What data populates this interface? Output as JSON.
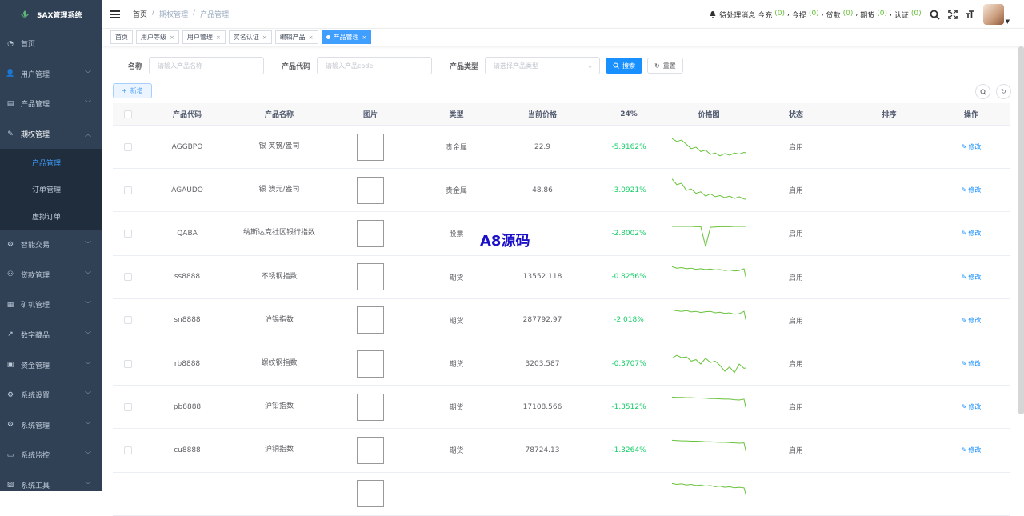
{
  "app": {
    "title": "SAX管理系统"
  },
  "sidebar": {
    "items": [
      {
        "label": "首页",
        "icon": "dashboard-icon",
        "has_arrow": false
      },
      {
        "label": "用户管理",
        "icon": "user-icon",
        "has_arrow": true
      },
      {
        "label": "产品管理",
        "icon": "document-icon",
        "has_arrow": true
      },
      {
        "label": "期权管理",
        "icon": "edit-icon",
        "has_arrow": true,
        "open": true,
        "children": [
          {
            "label": "产品管理",
            "active": true
          },
          {
            "label": "订单管理",
            "active": false
          },
          {
            "label": "虚拟订单",
            "active": false
          }
        ]
      },
      {
        "label": "智能交易",
        "icon": "gear-icon",
        "has_arrow": true
      },
      {
        "label": "贷款管理",
        "icon": "people-icon",
        "has_arrow": true
      },
      {
        "label": "矿机管理",
        "icon": "chart-icon",
        "has_arrow": true
      },
      {
        "label": "数字藏品",
        "icon": "trend-icon",
        "has_arrow": true
      },
      {
        "label": "资金管理",
        "icon": "money-icon",
        "has_arrow": true
      },
      {
        "label": "系统设置",
        "icon": "settings-icon",
        "has_arrow": true
      },
      {
        "label": "系统管理",
        "icon": "system-icon",
        "has_arrow": true
      },
      {
        "label": "系统监控",
        "icon": "monitor-icon",
        "has_arrow": true
      },
      {
        "label": "系统工具",
        "icon": "tool-icon",
        "has_arrow": true
      }
    ]
  },
  "breadcrumb": {
    "home": "首页",
    "sep": "/",
    "level1": "期权管理",
    "level2": "产品管理"
  },
  "notices": {
    "label": "待处理消息",
    "items": [
      {
        "label": "今充",
        "count": "(0)"
      },
      {
        "label": "今提",
        "count": "(0)"
      },
      {
        "label": "贷款",
        "count": "(0)"
      },
      {
        "label": "期货",
        "count": "(0)"
      },
      {
        "label": "认证",
        "count": "(0)"
      }
    ]
  },
  "tags": [
    {
      "label": "首页",
      "closable": false,
      "active": false
    },
    {
      "label": "用户等级",
      "closable": true,
      "active": false
    },
    {
      "label": "用户管理",
      "closable": true,
      "active": false
    },
    {
      "label": "实名认证",
      "closable": true,
      "active": false
    },
    {
      "label": "编辑产品",
      "closable": true,
      "active": false
    },
    {
      "label": "产品管理",
      "closable": true,
      "active": true
    }
  ],
  "filter": {
    "name_label": "名称",
    "name_placeholder": "请输入产品名称",
    "code_label": "产品代码",
    "code_placeholder": "请输入产品code",
    "type_label": "产品类型",
    "type_placeholder": "请选择产品类型",
    "search_label": "搜索",
    "reset_label": "重置"
  },
  "toolbar": {
    "add_label": "新增"
  },
  "table": {
    "headers": [
      "产品代码",
      "产品名称",
      "图片",
      "类型",
      "当前价格",
      "24%",
      "价格图",
      "状态",
      "排序",
      "操作"
    ],
    "edit_label": "修改",
    "rows": [
      {
        "code": "AGGBPO",
        "name": "银 英镑/盎司",
        "type": "贵金属",
        "price": "22.9",
        "change": "-5.9162%",
        "status": "启用",
        "spark": [
          0.2,
          0.3,
          0.25,
          0.4,
          0.55,
          0.5,
          0.65,
          0.6,
          0.75,
          0.7,
          0.8,
          0.72,
          0.78,
          0.7,
          0.74,
          0.68,
          0.72
        ]
      },
      {
        "code": "AGAUDO",
        "name": "银 澳元/盎司",
        "type": "贵金属",
        "price": "48.86",
        "change": "-3.0921%",
        "status": "启用",
        "spark": [
          0.1,
          0.3,
          0.25,
          0.5,
          0.45,
          0.6,
          0.55,
          0.7,
          0.62,
          0.72,
          0.68,
          0.75,
          0.7,
          0.78,
          0.72,
          0.8,
          0.82
        ]
      },
      {
        "code": "QABA",
        "name": "纳斯达克社区银行指数",
        "type": "股票",
        "price": "",
        "change": "-2.8002%",
        "status": "启用",
        "spark": [
          0.25,
          0.25,
          0.25,
          0.25,
          0.25,
          0.26,
          0.26,
          0.95,
          0.28,
          0.27,
          0.26,
          0.26,
          0.26,
          0.25,
          0.25,
          0.25,
          0.25
        ]
      },
      {
        "code": "ss8888",
        "name": "不锈钢指数",
        "type": "期货",
        "price": "13552.118",
        "change": "-0.8256%",
        "status": "启用",
        "spark": [
          0.15,
          0.2,
          0.18,
          0.22,
          0.2,
          0.24,
          0.22,
          0.25,
          0.23,
          0.26,
          0.25,
          0.28,
          0.26,
          0.3,
          0.28,
          0.22,
          0.98
        ]
      },
      {
        "code": "sn8888",
        "name": "沪锡指数",
        "type": "期货",
        "price": "287792.97",
        "change": "-2.018%",
        "status": "启用",
        "spark": [
          0.15,
          0.18,
          0.2,
          0.17,
          0.22,
          0.2,
          0.24,
          0.21,
          0.2,
          0.25,
          0.23,
          0.27,
          0.25,
          0.3,
          0.28,
          0.2,
          0.97
        ]
      },
      {
        "code": "rb8888",
        "name": "螺纹钢指数",
        "type": "期货",
        "price": "3203.587",
        "change": "-0.3707%",
        "status": "启用",
        "spark": [
          0.3,
          0.2,
          0.28,
          0.25,
          0.4,
          0.35,
          0.5,
          0.3,
          0.45,
          0.4,
          0.55,
          0.75,
          0.6,
          0.8,
          0.5,
          0.65,
          0.62
        ]
      },
      {
        "code": "pb8888",
        "name": "沪铅指数",
        "type": "期货",
        "price": "17108.566",
        "change": "-1.3512%",
        "status": "启用",
        "spark": [
          0.15,
          0.16,
          0.16,
          0.17,
          0.17,
          0.18,
          0.18,
          0.19,
          0.2,
          0.2,
          0.21,
          0.22,
          0.22,
          0.24,
          0.25,
          0.22,
          0.98
        ]
      },
      {
        "code": "cu8888",
        "name": "沪铜指数",
        "type": "期货",
        "price": "78724.13",
        "change": "-1.3264%",
        "status": "启用",
        "spark": [
          0.15,
          0.16,
          0.17,
          0.17,
          0.18,
          0.18,
          0.19,
          0.2,
          0.2,
          0.21,
          0.22,
          0.22,
          0.23,
          0.24,
          0.25,
          0.24,
          0.98
        ]
      },
      {
        "code": "",
        "name": "",
        "type": "",
        "price": "",
        "change": "",
        "status": "",
        "spark": [
          0.15,
          0.18,
          0.16,
          0.2,
          0.18,
          0.22,
          0.2,
          0.24,
          0.22,
          0.26,
          0.24,
          0.28,
          0.26,
          0.3,
          0.28,
          0.3,
          0.9
        ]
      }
    ]
  },
  "watermark": "A8源码",
  "colors": {
    "sidebar_bg": "#304156",
    "submenu_bg": "#1f2d3d",
    "accent": "#1890ff",
    "positive": "#13ce66",
    "spark": "#67c23a"
  }
}
